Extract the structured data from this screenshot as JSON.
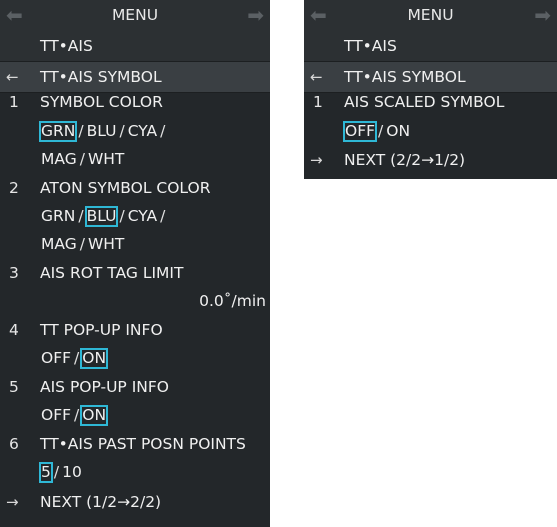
{
  "left": {
    "title": "MENU",
    "header": "TT•AIS",
    "back_glyph": "←",
    "back_label": "TT•AIS SYMBOL",
    "items": {
      "i1": {
        "num": "1",
        "label": "SYMBOL COLOR",
        "opt_grn": "GRN",
        "opt_blu": "BLU",
        "opt_cya": "CYA",
        "opt_mag": "MAG",
        "opt_wht": "WHT",
        "sep": "/",
        "selected": "GRN"
      },
      "i2": {
        "num": "2",
        "label": "ATON SYMBOL COLOR",
        "opt_grn": "GRN",
        "opt_blu": "BLU",
        "opt_cya": "CYA",
        "opt_mag": "MAG",
        "opt_wht": "WHT",
        "sep": "/",
        "selected": "BLU"
      },
      "i3": {
        "num": "3",
        "label": "AIS ROT TAG LIMIT",
        "value": "0.0˚/min"
      },
      "i4": {
        "num": "4",
        "label": "TT POP-UP INFO",
        "opt_off": "OFF",
        "opt_on": "ON",
        "sep": "/",
        "selected": "ON"
      },
      "i5": {
        "num": "5",
        "label": "AIS POP-UP INFO",
        "opt_off": "OFF",
        "opt_on": "ON",
        "sep": "/",
        "selected": "ON"
      },
      "i6": {
        "num": "6",
        "label": "TT•AIS PAST POSN POINTS",
        "opt_5": "5",
        "opt_10": "10",
        "sep": "/",
        "selected": "5"
      }
    },
    "next_glyph": "→",
    "next_label": "NEXT (1/2→2/2)"
  },
  "right": {
    "title": "MENU",
    "header": "TT•AIS",
    "back_glyph": "←",
    "back_label": "TT•AIS SYMBOL",
    "items": {
      "i1": {
        "num": "1",
        "label": "AIS SCALED SYMBOL",
        "opt_off": "OFF",
        "opt_on": "ON",
        "sep": "/",
        "selected": "OFF"
      }
    },
    "next_glyph": "→",
    "next_label": "NEXT (2/2→1/2)"
  },
  "colors": {
    "panel_bg": "#23272a",
    "header_bg": "#2c3033",
    "selected_row_bg": "#3a3f43",
    "text": "#f0f0f0",
    "selection_outline": "#2fb8d6"
  },
  "icons": {
    "title_left": "arrow-left-icon",
    "title_right": "arrow-right-icon",
    "back": "arrow-left-icon",
    "next": "arrow-right-icon"
  }
}
